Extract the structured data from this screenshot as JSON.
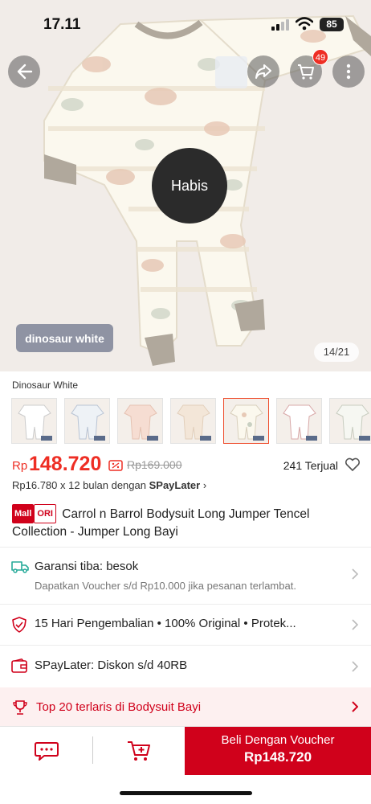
{
  "status_bar": {
    "time": "17.11",
    "battery": "85"
  },
  "hero": {
    "cart_count": "49",
    "stock_overlay": "Habis",
    "variant_chip": "dinosaur white",
    "image_counter": "14/21"
  },
  "variant": {
    "name": "Dinosaur White",
    "thumb_count": 7,
    "selected_index": 4
  },
  "price": {
    "currency": "Rp",
    "value": "148.720",
    "original": "Rp169.000",
    "sold": "241 Terjual"
  },
  "spaylater": {
    "text": "Rp16.780 x 12 bulan dengan",
    "brand": "SPayLater"
  },
  "product": {
    "mall_badge": "Mall",
    "ori_badge": "ORI",
    "title": "Carrol n Barrol Bodysuit Long Jumper Tencel Collection - Jumper Long Bayi"
  },
  "rows": {
    "shipping": {
      "label": "Garansi tiba: besok",
      "sub": "Dapatkan Voucher s/d Rp10.000 jika pesanan terlambat."
    },
    "guarantee": {
      "label": "15 Hari Pengembalian  •  100% Original  •  Protek..."
    },
    "paylater": {
      "label": "SPayLater: Diskon s/d 40RB"
    },
    "top": {
      "label": "Top 20 terlaris di Bodysuit Bayi"
    }
  },
  "bottom_bar": {
    "buy_label": "Beli Dengan Voucher",
    "buy_price": "Rp148.720"
  },
  "colors": {
    "accent": "#ee2e24",
    "brand": "#d0011b"
  }
}
